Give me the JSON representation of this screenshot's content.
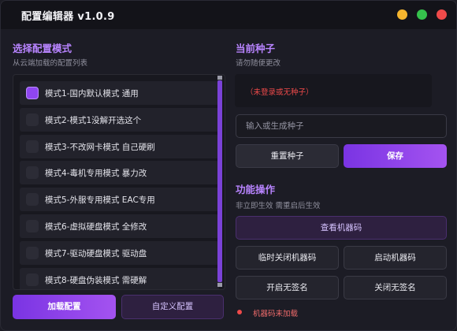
{
  "app": {
    "title": "配置编辑器 v1.0.9"
  },
  "left": {
    "title": "选择配置模式",
    "subtitle": "从云端加载的配置列表",
    "modes": [
      {
        "label": "模式1-国内默认模式 通用",
        "checked": true
      },
      {
        "label": "模式2-模式1没解开选这个",
        "checked": false
      },
      {
        "label": "模式3-不改网卡模式 自己硬刷",
        "checked": false
      },
      {
        "label": "模式4-毒机专用模式 暴力改",
        "checked": false
      },
      {
        "label": "模式5-外服专用模式 EAC专用",
        "checked": false
      },
      {
        "label": "模式6-虚拟硬盘模式 全修改",
        "checked": false
      },
      {
        "label": "模式7-驱动硬盘模式 驱动盘",
        "checked": false
      },
      {
        "label": "模式8-硬盘伪装模式 需硬解",
        "checked": false
      }
    ],
    "load_button": "加载配置",
    "custom_button": "自定义配置"
  },
  "seed": {
    "title": "当前种子",
    "subtitle": "请勿随便更改",
    "status": "（未登录或无种子）",
    "input_placeholder": "输入或生成种子",
    "reset_button": "重置种子",
    "save_button": "保存"
  },
  "functions": {
    "title": "功能操作",
    "subtitle": "非立即生效 需重启后生效",
    "view_machine_code": "查看机器码",
    "temp_close_machine_code": "临时关闭机器码",
    "start_machine_code": "启动机器码",
    "enable_no_sign": "开启无签名",
    "disable_no_sign": "关闭无签名",
    "machine_code_status": "机器码未加载"
  },
  "colors": {
    "accent": "#9b4cf0",
    "section_title": "#b884ff",
    "error": "#ef4a4a",
    "background": "#1c1c25"
  },
  "icons": {
    "minimize": "yellow-circle",
    "maximize": "green-circle",
    "close": "red-circle",
    "status": "red-dot"
  }
}
